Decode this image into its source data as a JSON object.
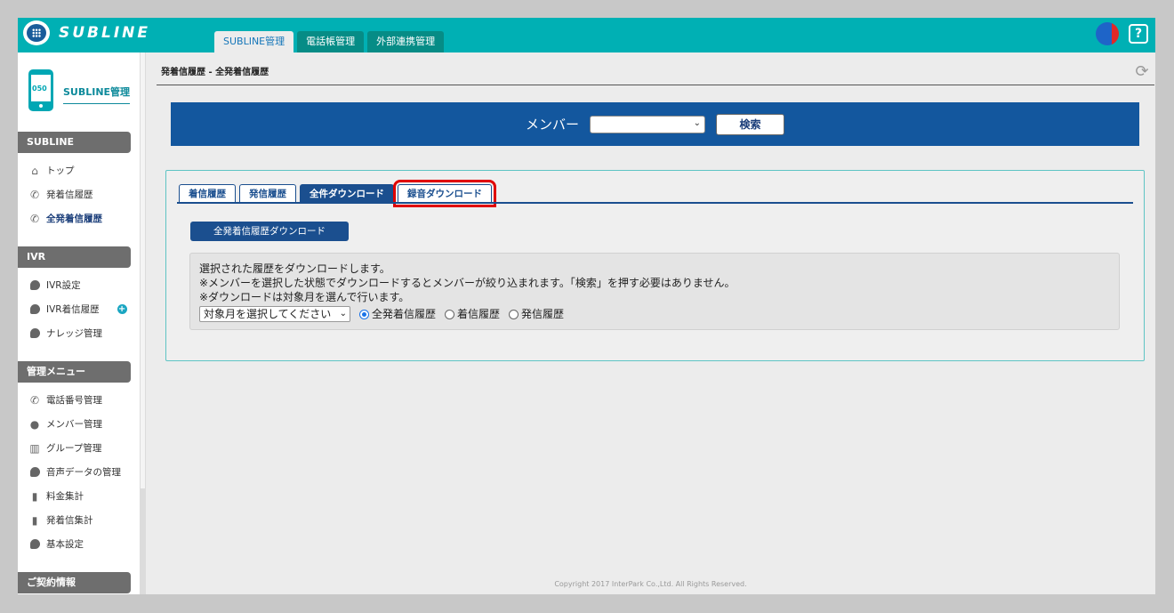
{
  "header": {
    "logo_text": "SUBLINE",
    "tabs": [
      {
        "label": "SUBLINE管理",
        "active": true
      },
      {
        "label": "電話帳管理",
        "active": false
      },
      {
        "label": "外部連携管理",
        "active": false
      }
    ],
    "help_label": "?"
  },
  "sidebar": {
    "title": "SUBLINE管理",
    "phone_badge": "050",
    "sections": [
      {
        "label": "SUBLINE",
        "items": [
          {
            "label": "トップ",
            "icon": "home-icon"
          },
          {
            "label": "発着信履歴",
            "icon": "phone-icon"
          },
          {
            "label": "全発着信履歴",
            "icon": "phone-icon",
            "active": true
          }
        ]
      },
      {
        "label": "IVR",
        "items": [
          {
            "label": "IVR設定",
            "icon": "bubble-icon"
          },
          {
            "label": "IVR着信履歴",
            "icon": "bubble-icon"
          },
          {
            "label": "ナレッジ管理",
            "icon": "bubble-icon"
          }
        ]
      },
      {
        "label": "管理メニュー",
        "items": [
          {
            "label": "電話番号管理",
            "icon": "phone-icon"
          },
          {
            "label": "メンバー管理",
            "icon": "person-icon"
          },
          {
            "label": "グループ管理",
            "icon": "building-icon"
          },
          {
            "label": "音声データの管理",
            "icon": "bubble-icon"
          },
          {
            "label": "料金集計",
            "icon": "bar-chart-icon"
          },
          {
            "label": "発着信集計",
            "icon": "bar-chart-icon"
          },
          {
            "label": "基本設定",
            "icon": "bubble-icon"
          }
        ]
      },
      {
        "label": "ご契約情報",
        "items": []
      }
    ]
  },
  "breadcrumb": "発着信履歴 - 全発着信履歴",
  "member_bar": {
    "label": "メンバー",
    "select_value": "",
    "search_label": "検索"
  },
  "sub_tabs": [
    {
      "label": "着信履歴",
      "active": false
    },
    {
      "label": "発信履歴",
      "active": false
    },
    {
      "label": "全件ダウンロード",
      "active": true
    },
    {
      "label": "録音ダウンロード",
      "active": false,
      "highlighted": true
    }
  ],
  "download_all_label": "全発着信履歴ダウンロード",
  "info": {
    "line1": "選択された履歴をダウンロードします。",
    "line2": "※メンバーを選択した状態でダウンロードするとメンバーが絞り込まれます。「検索」を押す必要はありません。",
    "line3": "※ダウンロードは対象月を選んで行います。",
    "month_select": "対象月を選択してください",
    "radios": [
      {
        "label": "全発着信履歴",
        "checked": true
      },
      {
        "label": "着信履歴",
        "checked": false
      },
      {
        "label": "発信履歴",
        "checked": false
      }
    ]
  },
  "copyright": "Copyright 2017 InterPark Co.,Ltd. All Rights Reserved.",
  "colors": {
    "topbar": "#00b0b4",
    "primary_blue": "#13579e",
    "highlight_red": "#e00000"
  }
}
